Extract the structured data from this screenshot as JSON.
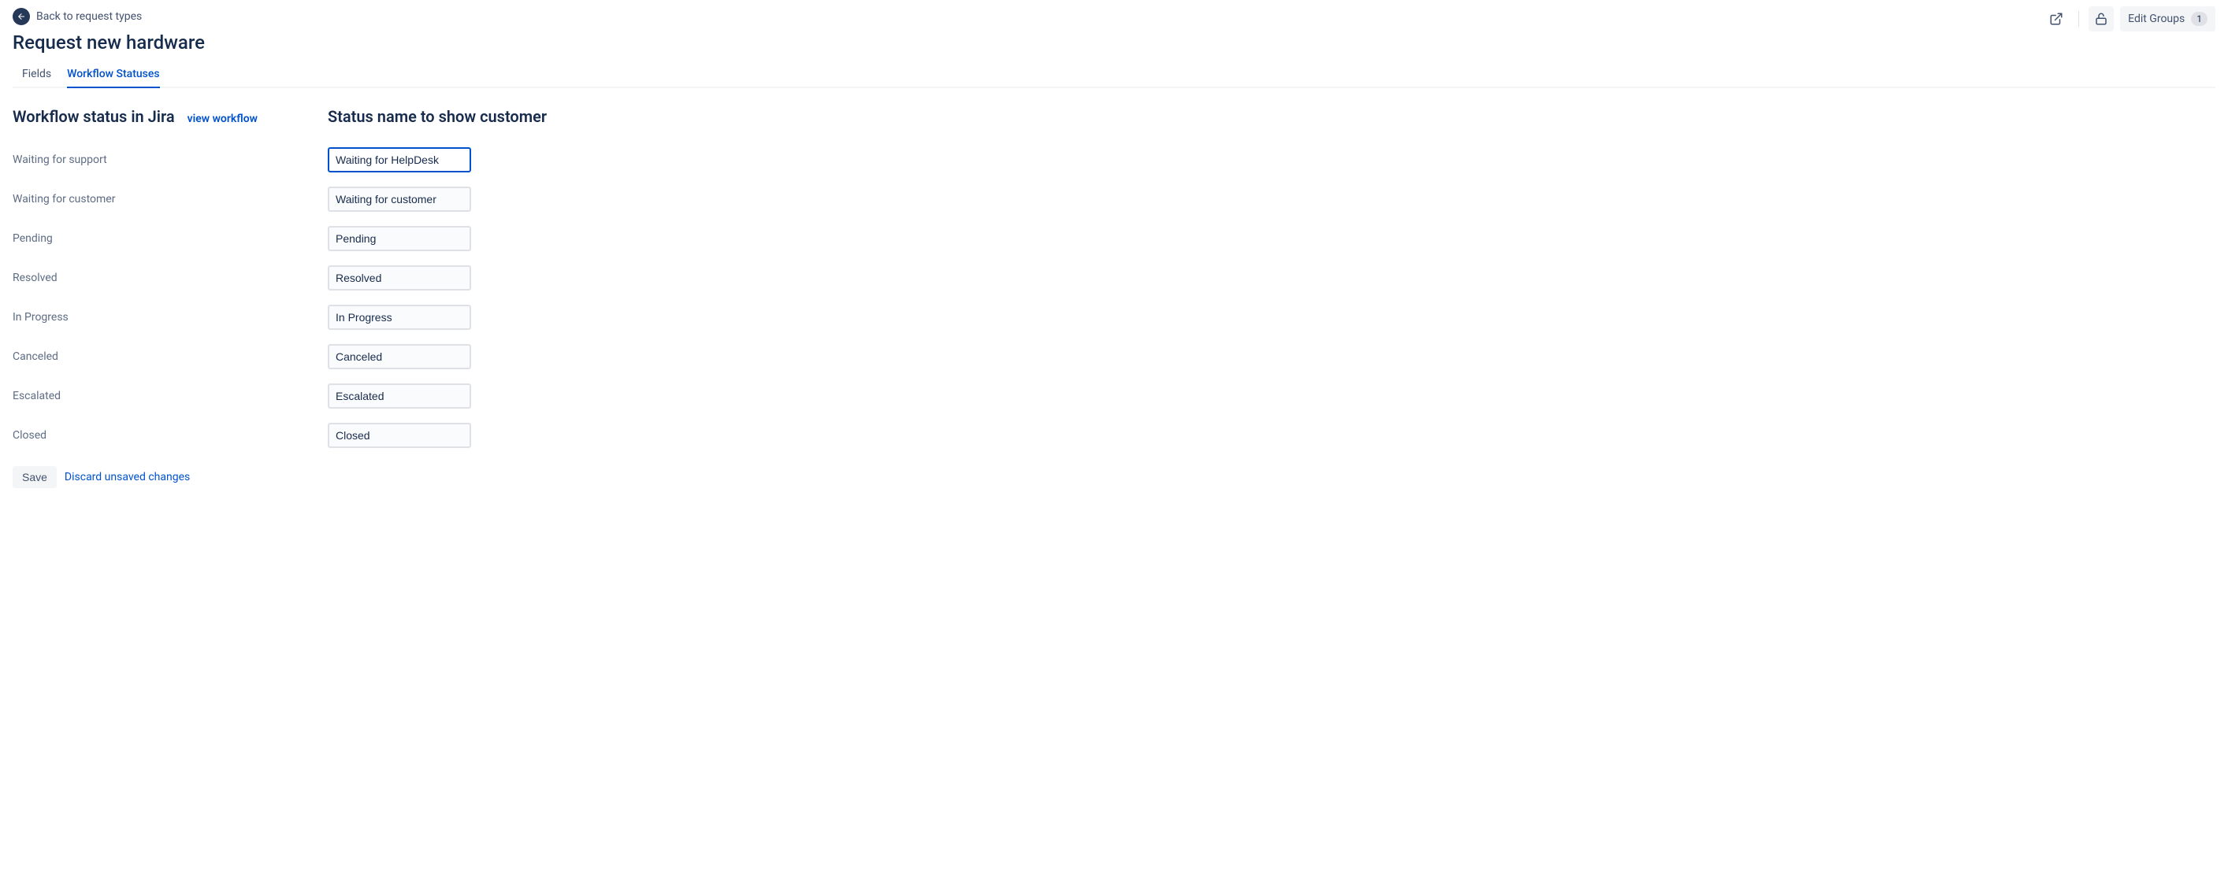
{
  "back_link": "Back to request types",
  "page_title": "Request new hardware",
  "tabs": {
    "fields": "Fields",
    "workflow_statuses": "Workflow Statuses"
  },
  "top_actions": {
    "edit_groups_label": "Edit Groups",
    "edit_groups_count": "1"
  },
  "columns": {
    "jira_status_header": "Workflow status in Jira",
    "view_workflow": "view workflow",
    "customer_status_header": "Status name to show customer"
  },
  "statuses": [
    {
      "jira": "Waiting for support",
      "customer": "Waiting for HelpDesk"
    },
    {
      "jira": "Waiting for customer",
      "customer": "Waiting for customer"
    },
    {
      "jira": "Pending",
      "customer": "Pending"
    },
    {
      "jira": "Resolved",
      "customer": "Resolved"
    },
    {
      "jira": "In Progress",
      "customer": "In Progress"
    },
    {
      "jira": "Canceled",
      "customer": "Canceled"
    },
    {
      "jira": "Escalated",
      "customer": "Escalated"
    },
    {
      "jira": "Closed",
      "customer": "Closed"
    }
  ],
  "actions": {
    "save": "Save",
    "discard": "Discard unsaved changes"
  }
}
